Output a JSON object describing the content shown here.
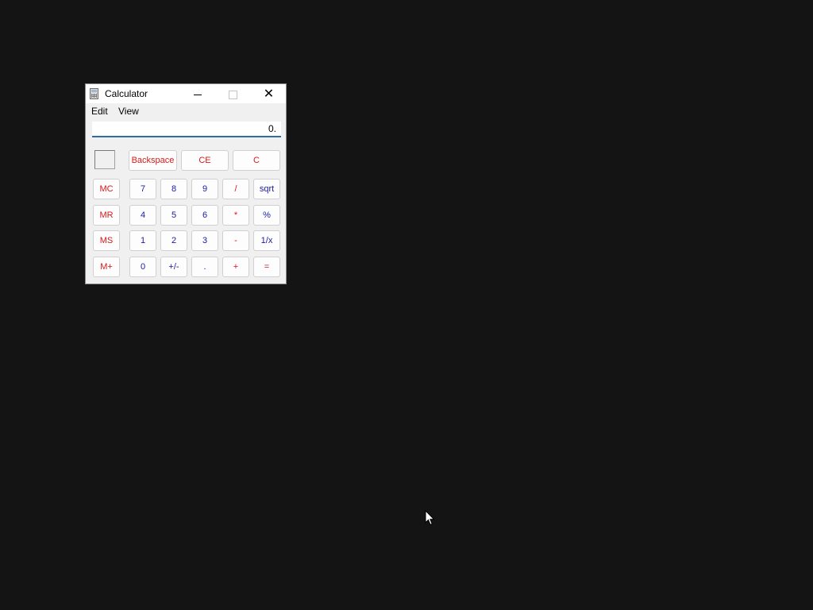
{
  "window": {
    "title": "Calculator",
    "controls": {
      "minimize": "minimize",
      "maximize": "maximize",
      "close": "close"
    }
  },
  "menu": {
    "edit": "Edit",
    "view": "View"
  },
  "display": {
    "value": "0."
  },
  "top_buttons": {
    "backspace": "Backspace",
    "ce": "CE",
    "c": "C"
  },
  "memory": {
    "mc": "MC",
    "mr": "MR",
    "ms": "MS",
    "mplus": "M+"
  },
  "keys": {
    "k7": "7",
    "k8": "8",
    "k9": "9",
    "div": "/",
    "sqrt": "sqrt",
    "k4": "4",
    "k5": "5",
    "k6": "6",
    "mul": "*",
    "pct": "%",
    "k1": "1",
    "k2": "2",
    "k3": "3",
    "sub": "-",
    "recip": "1/x",
    "k0": "0",
    "neg": "+/-",
    "dot": ".",
    "add": "+",
    "eq": "="
  },
  "colors": {
    "desktop": "#141414",
    "operator_red": "#d81818",
    "digit_blue": "#1a1aa6",
    "display_underline": "#2e6da4"
  },
  "icons": {
    "app": "calculator-icon",
    "minimize": "minimize-icon",
    "maximize": "maximize-icon",
    "close": "close-icon",
    "cursor": "mouse-pointer-icon"
  }
}
